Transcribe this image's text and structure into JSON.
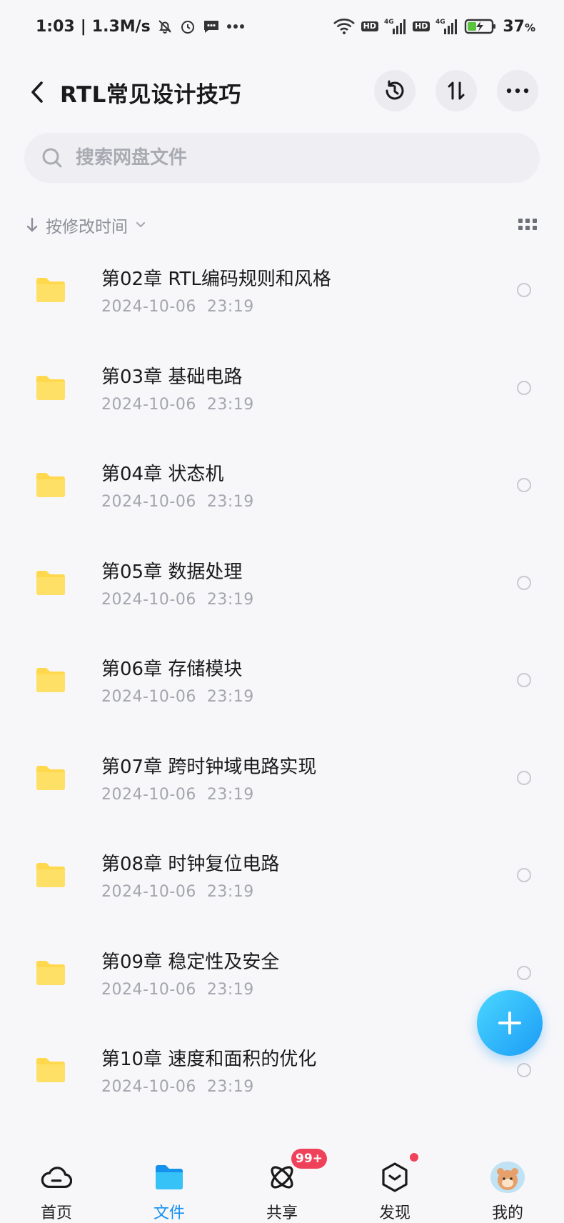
{
  "status_bar": {
    "time": "1:03",
    "speed": "1.3M/s",
    "hd1": "HD",
    "net1": "4G",
    "hd2": "HD",
    "net2": "4G",
    "battery": "37",
    "battery_unit": "%"
  },
  "header": {
    "title": "RTL常见设计技巧"
  },
  "search": {
    "placeholder": "搜索网盘文件"
  },
  "sort": {
    "label": "按修改时间"
  },
  "files": [
    {
      "name": "第02章 RTL编码规则和风格",
      "date": "2024-10-06  23:19"
    },
    {
      "name": "第03章 基础电路",
      "date": "2024-10-06  23:19"
    },
    {
      "name": "第04章 状态机",
      "date": "2024-10-06  23:19"
    },
    {
      "name": "第05章 数据处理",
      "date": "2024-10-06  23:19"
    },
    {
      "name": "第06章 存储模块",
      "date": "2024-10-06  23:19"
    },
    {
      "name": "第07章 跨时钟域电路实现",
      "date": "2024-10-06  23:19"
    },
    {
      "name": "第08章 时钟复位电路",
      "date": "2024-10-06  23:19"
    },
    {
      "name": "第09章 稳定性及安全",
      "date": "2024-10-06  23:19"
    },
    {
      "name": "第10章 速度和面积的优化",
      "date": "2024-10-06  23:19"
    }
  ],
  "bottom_nav": {
    "home": "首页",
    "files": "文件",
    "share": "共享",
    "share_badge": "99+",
    "discover": "发现",
    "mine": "我的"
  },
  "colors": {
    "accent": "#1592f0",
    "folder": "#ffd84d",
    "badge": "#f0415a"
  }
}
